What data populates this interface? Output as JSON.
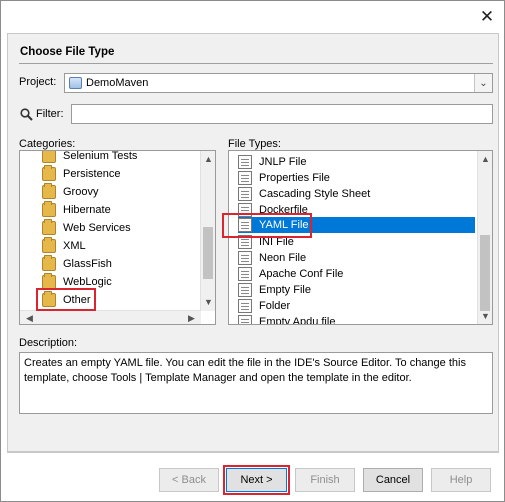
{
  "window": {
    "close_glyph": "✕"
  },
  "step_title": "Choose File Type",
  "project": {
    "label": "Project:",
    "value": "DemoMaven",
    "icon": "maven-project-icon"
  },
  "filter": {
    "label": "Filter:",
    "value": ""
  },
  "categories": {
    "label": "Categories:",
    "items": [
      {
        "label": "Selenium Tests"
      },
      {
        "label": "Persistence"
      },
      {
        "label": "Groovy"
      },
      {
        "label": "Hibernate"
      },
      {
        "label": "Web Services"
      },
      {
        "label": "XML"
      },
      {
        "label": "GlassFish"
      },
      {
        "label": "WebLogic"
      },
      {
        "label": "Other"
      }
    ],
    "selected": "Other"
  },
  "file_types": {
    "label": "File Types:",
    "items": [
      {
        "label": "JNLP File"
      },
      {
        "label": "Properties File"
      },
      {
        "label": "Cascading Style Sheet"
      },
      {
        "label": "Dockerfile"
      },
      {
        "label": "YAML File"
      },
      {
        "label": "INI File"
      },
      {
        "label": "Neon File"
      },
      {
        "label": "Apache Conf File"
      },
      {
        "label": "Empty File"
      },
      {
        "label": "Folder"
      },
      {
        "label": "Empty Apdu file"
      }
    ],
    "selected": "YAML File"
  },
  "description": {
    "label": "Description:",
    "text": "Creates an empty YAML file. You can edit the file in the IDE's Source Editor. To change this template, choose Tools | Template Manager and open the template in the editor."
  },
  "buttons": {
    "back": "< Back",
    "next": "Next >",
    "finish": "Finish",
    "cancel": "Cancel",
    "help": "Help"
  },
  "colors": {
    "selection": "#0078d7",
    "highlight_box": "#d9252f"
  }
}
